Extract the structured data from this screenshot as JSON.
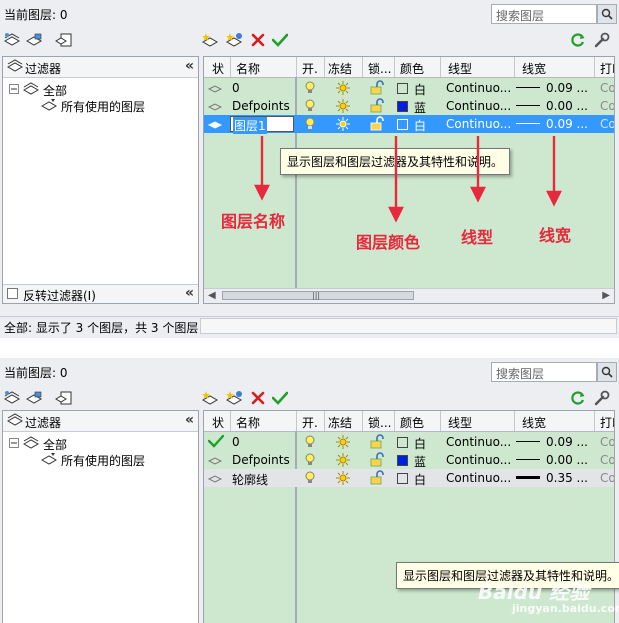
{
  "panels": [
    {
      "current_layer": "当前图层: 0",
      "search_placeholder": "搜索图层",
      "filter_title": "过滤器",
      "tree": {
        "all": "全部",
        "used": "所有使用的图层"
      },
      "invert_filter": "反转过滤器(I)",
      "columns": {
        "status": "状",
        "name": "名称",
        "on": "开.",
        "freeze": "冻结",
        "lock": "锁...",
        "color": "颜色",
        "linetype": "线型",
        "lineweight": "线宽",
        "plot": "打印"
      },
      "rows": [
        {
          "status": "",
          "name": "0",
          "color_name": "白",
          "color": "#ffffff",
          "linetype": "Continuo...",
          "lineweight": "0.09 ...",
          "plot": "Col",
          "selected": false,
          "lw_thick": false
        },
        {
          "status": "",
          "name": "Defpoints",
          "color_name": "蓝",
          "color": "#0020e0",
          "linetype": "Continuo...",
          "lineweight": "0.00 ...",
          "plot": "Col",
          "selected": false,
          "lw_thick": false
        },
        {
          "status": "current",
          "name": "图层1",
          "color_name": "白",
          "color": "#ffffff",
          "linetype": "Continuo...",
          "lineweight": "0.09 ...",
          "plot": "Col",
          "selected": true,
          "lw_thick": false
        }
      ],
      "tooltip": "显示图层和图层过滤器及其特性和说明。",
      "status_text": "全部: 显示了 3 个图层，共 3 个图层",
      "annotations": {
        "name": "图层名称",
        "color": "图层颜色",
        "linetype": "线型",
        "lineweight": "线宽"
      }
    },
    {
      "current_layer": "当前图层: 0",
      "search_placeholder": "搜索图层",
      "filter_title": "过滤器",
      "tree": {
        "all": "全部",
        "used": "所有使用的图层"
      },
      "columns": {
        "status": "状",
        "name": "名称",
        "on": "开.",
        "freeze": "冻结",
        "lock": "锁...",
        "color": "颜色",
        "linetype": "线型",
        "lineweight": "线宽",
        "plot": "打印"
      },
      "rows": [
        {
          "status": "current",
          "name": "0",
          "color_name": "白",
          "color": "#ffffff",
          "linetype": "Continuo...",
          "lineweight": "0.09 ...",
          "plot": "Col",
          "selected": false,
          "lw_thick": false
        },
        {
          "status": "",
          "name": "Defpoints",
          "color_name": "蓝",
          "color": "#0020e0",
          "linetype": "Continuo...",
          "lineweight": "0.00 ...",
          "plot": "Col",
          "selected": false,
          "lw_thick": false
        },
        {
          "status": "",
          "name": "轮廓线",
          "color_name": "白",
          "color": "#ffffff",
          "linetype": "Continuo...",
          "lineweight": "0.35 ...",
          "plot": "Col",
          "selected": false,
          "lw_thick": true
        }
      ],
      "tooltip": "显示图层和图层过滤器及其特性和说明。"
    }
  ],
  "watermark": {
    "brand": "Baidu 经验",
    "url": "jingyan.baidu.com"
  },
  "colors": {
    "panel_bg": "#eceef2",
    "list_bg": "#cde8cf",
    "selection": "#3399ff",
    "annotation": "#e8283c"
  }
}
